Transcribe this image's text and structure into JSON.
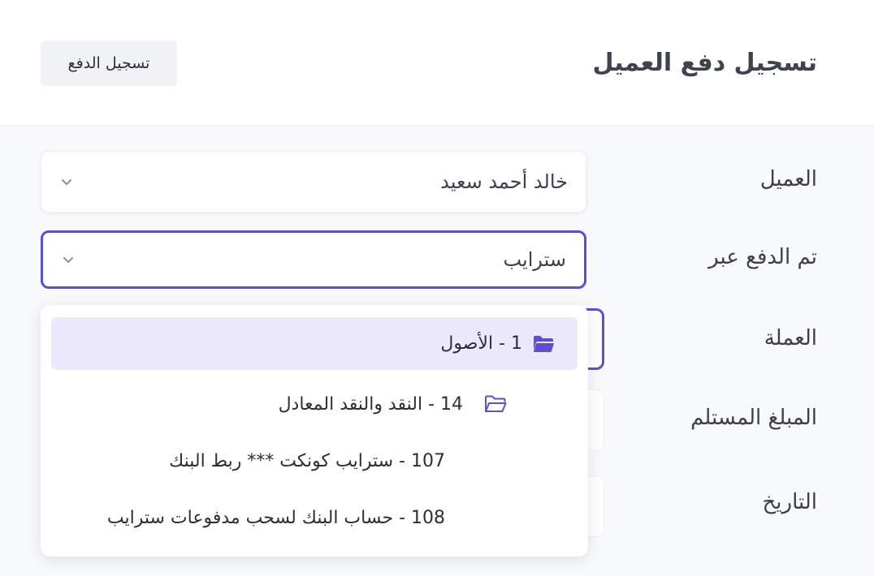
{
  "header": {
    "title": "تسجيل دفع العميل",
    "record_button": "تسجيل الدفع"
  },
  "form": {
    "customer_label": "العميل",
    "customer_value": "خالد أحمد سعيد",
    "paid_via_label": "تم الدفع عبر",
    "paid_via_value": "سترايب",
    "currency_label": "العملة",
    "amount_label": "المبلغ المستلم",
    "date_label": "التاريخ"
  },
  "dropdown": {
    "options": [
      {
        "label": "1 - الأصول",
        "icon": "folder-open-icon",
        "selected": true
      },
      {
        "label": "14 - النقد والنقد المعادل",
        "icon": "folder-icon"
      },
      {
        "label": "107 - سترايب كونكت *** ربط البنك"
      },
      {
        "label": "108 - حساب البنك لسحب مدفوعات سترايب"
      }
    ]
  },
  "colors": {
    "accent": "#5b4fd6",
    "selected_bg": "#ece9fd"
  }
}
